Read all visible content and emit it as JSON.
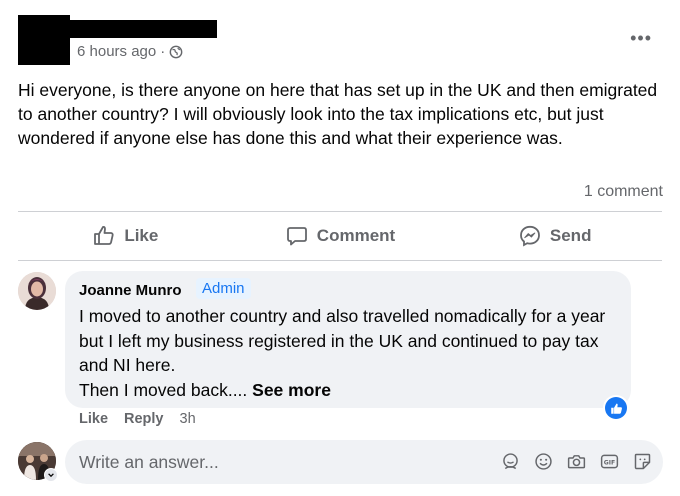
{
  "post": {
    "time": "6 hours ago",
    "separator": "·",
    "privacy_icon": "globe-icon",
    "more_icon": "more-options-icon",
    "more_label": "•••",
    "text": "Hi everyone, is there anyone on here that has set up in the UK and then emigrated to another country? I will obviously look into the tax implications etc, but just wondered if anyone else has done this and what their experience was.",
    "comment_count": "1 comment"
  },
  "actions": {
    "like": "Like",
    "comment": "Comment",
    "send": "Send"
  },
  "comment": {
    "author": "Joanne Munro",
    "badge": "Admin",
    "text": "I moved to another country and also travelled nomadically for a year but I left my business registered in the UK and continued to pay tax and NI here.",
    "text_line2": "Then I moved back....",
    "see_more": "See more",
    "like": "Like",
    "reply": "Reply",
    "time": "3h",
    "reaction_icon": "thumbs-up-icon"
  },
  "composer": {
    "placeholder": "Write an answer...",
    "icons": [
      "avatar-sticker-icon",
      "emoji-icon",
      "camera-icon",
      "gif-icon",
      "sticker-icon"
    ]
  },
  "colors": {
    "accent": "#1877f2",
    "muted": "#65676b",
    "bubble": "#f0f2f5"
  }
}
